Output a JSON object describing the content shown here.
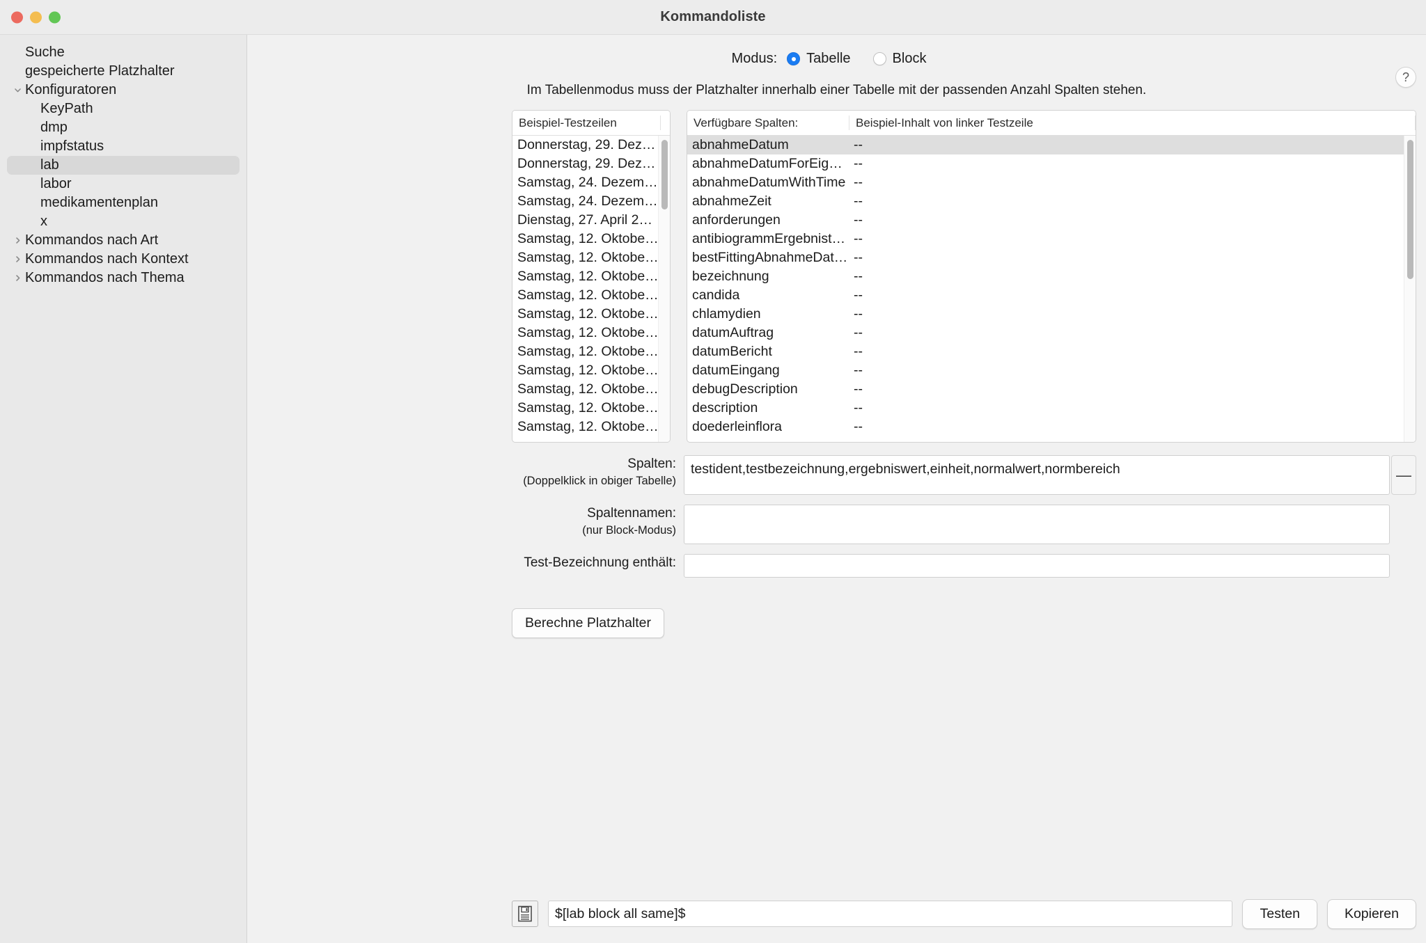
{
  "window": {
    "title": "Kommandoliste",
    "traffic_lights": [
      "close",
      "minimize",
      "maximize"
    ]
  },
  "sidebar": {
    "items": [
      {
        "label": "Suche",
        "level": 0,
        "twisty": "none",
        "selected": false
      },
      {
        "label": "gespeicherte Platzhalter",
        "level": 0,
        "twisty": "none",
        "selected": false
      },
      {
        "label": "Konfiguratoren",
        "level": 0,
        "twisty": "down",
        "selected": false
      },
      {
        "label": "KeyPath",
        "level": 1,
        "twisty": "none",
        "selected": false
      },
      {
        "label": "dmp",
        "level": 1,
        "twisty": "none",
        "selected": false
      },
      {
        "label": "impfstatus",
        "level": 1,
        "twisty": "none",
        "selected": false
      },
      {
        "label": "lab",
        "level": 1,
        "twisty": "none",
        "selected": true
      },
      {
        "label": "labor",
        "level": 1,
        "twisty": "none",
        "selected": false
      },
      {
        "label": "medikamentenplan",
        "level": 1,
        "twisty": "none",
        "selected": false
      },
      {
        "label": "x",
        "level": 1,
        "twisty": "none",
        "selected": false
      },
      {
        "label": "Kommandos nach Art",
        "level": 0,
        "twisty": "right",
        "selected": false
      },
      {
        "label": "Kommandos nach Kontext",
        "level": 0,
        "twisty": "right",
        "selected": false
      },
      {
        "label": "Kommandos nach Thema",
        "level": 0,
        "twisty": "right",
        "selected": false
      }
    ]
  },
  "main": {
    "help_label": "?",
    "modus": {
      "label": "Modus:",
      "options": [
        {
          "label": "Tabelle",
          "selected": true
        },
        {
          "label": "Block",
          "selected": false
        }
      ]
    },
    "hint": "Im Tabellenmodus muss der Platzhalter innerhalb einer Tabelle mit der passenden Anzahl Spalten stehen.",
    "left_table": {
      "header": "Beispiel-Testzeilen",
      "rows": [
        "Donnerstag, 29. Dez…",
        "Donnerstag, 29. Dez…",
        "Samstag, 24. Dezem…",
        "Samstag, 24. Dezem…",
        "Dienstag, 27. April 2…",
        "Samstag, 12. Oktobe…",
        "Samstag, 12. Oktobe…",
        "Samstag, 12. Oktobe…",
        "Samstag, 12. Oktobe…",
        "Samstag, 12. Oktobe…",
        "Samstag, 12. Oktobe…",
        "Samstag, 12. Oktobe…",
        "Samstag, 12. Oktobe…",
        "Samstag, 12. Oktobe…",
        "Samstag, 12. Oktobe…",
        "Samstag, 12. Oktobe…"
      ]
    },
    "right_table": {
      "header_col1": "Verfügbare Spalten:",
      "header_col2": "Beispiel-Inhalt von linker Testzeile",
      "rows": [
        {
          "name": "abnahmeDatum",
          "value": "--",
          "selected": true
        },
        {
          "name": "abnahmeDatumForEige…",
          "value": "--",
          "selected": false
        },
        {
          "name": "abnahmeDatumWithTime",
          "value": "--",
          "selected": false
        },
        {
          "name": "abnahmeZeit",
          "value": "--",
          "selected": false
        },
        {
          "name": "anforderungen",
          "value": "--",
          "selected": false
        },
        {
          "name": "antibiogrammErgebnist…",
          "value": "--",
          "selected": false
        },
        {
          "name": "bestFittingAbnahmeDat…",
          "value": "--",
          "selected": false
        },
        {
          "name": "bezeichnung",
          "value": "--",
          "selected": false
        },
        {
          "name": "candida",
          "value": "--",
          "selected": false
        },
        {
          "name": "chlamydien",
          "value": "--",
          "selected": false
        },
        {
          "name": "datumAuftrag",
          "value": "--",
          "selected": false
        },
        {
          "name": "datumBericht",
          "value": "--",
          "selected": false
        },
        {
          "name": "datumEingang",
          "value": "--",
          "selected": false
        },
        {
          "name": "debugDescription",
          "value": "--",
          "selected": false
        },
        {
          "name": "description",
          "value": "--",
          "selected": false
        },
        {
          "name": "doederleinflora",
          "value": "--",
          "selected": false
        }
      ]
    },
    "fields": {
      "spalten": {
        "label": "Spalten:",
        "sublabel": "(Doppelklick in obiger Tabelle)",
        "value": "testident,testbezeichnung,ergebniswert,einheit,normalwert,normbereich",
        "remove_button": "—"
      },
      "spaltennamen": {
        "label": "Spaltennamen:",
        "sublabel": "(nur Block-Modus)",
        "value": ""
      },
      "testbezeichnung": {
        "label": "Test-Bezeichnung enthält:",
        "value": ""
      }
    },
    "calc_button": "Berechne Platzhalter"
  },
  "bottom": {
    "save_icon": "save-disk-icon",
    "command_value": "$[lab block all same]$",
    "test_button": "Testen",
    "copy_button": "Kopieren"
  },
  "colors": {
    "accent": "#1a7cf2",
    "window_bg": "#ececec",
    "sidebar_bg": "#e9e9e9",
    "main_bg": "#f1f1f1",
    "selection": "#dedede",
    "traffic_red": "#ec6a5f",
    "traffic_yellow": "#f4bd50",
    "traffic_green": "#62c655"
  }
}
